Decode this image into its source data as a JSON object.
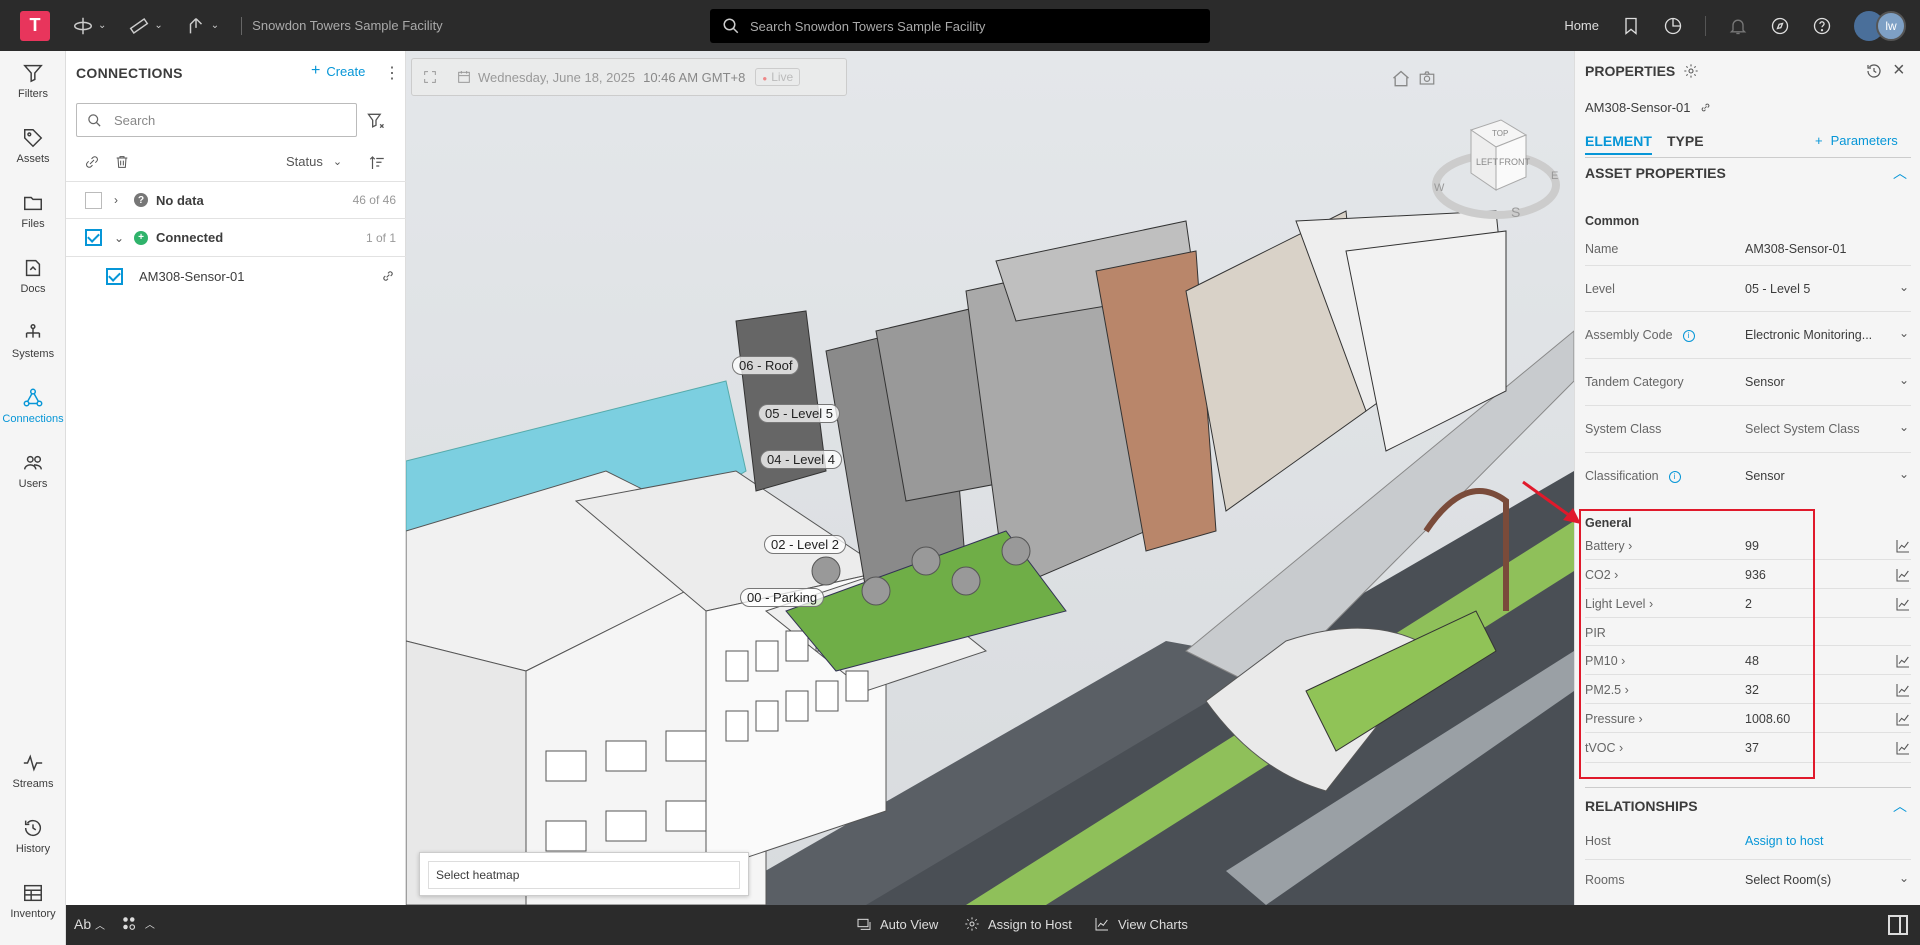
{
  "topbar": {
    "logo_letter": "T",
    "project_name": "Snowdon Towers Sample Facility",
    "search_placeholder": "Search Snowdon Towers Sample Facility",
    "home_label": "Home",
    "avatar_initials": "lw"
  },
  "rail": {
    "items": [
      {
        "label": "Filters",
        "icon": "filter-icon"
      },
      {
        "label": "Assets",
        "icon": "tag-icon"
      },
      {
        "label": "Files",
        "icon": "folder-icon"
      },
      {
        "label": "Docs",
        "icon": "docs-icon"
      },
      {
        "label": "Systems",
        "icon": "hierarchy-icon"
      },
      {
        "label": "Connections",
        "icon": "connections-icon",
        "active": true
      },
      {
        "label": "Users",
        "icon": "users-icon"
      }
    ],
    "bottom_items": [
      {
        "label": "Streams",
        "icon": "pulse-icon"
      },
      {
        "label": "History",
        "icon": "history-icon"
      },
      {
        "label": "Inventory",
        "icon": "table-icon"
      }
    ]
  },
  "connections": {
    "title": "CONNECTIONS",
    "create_label": "Create",
    "search_placeholder": "Search",
    "status_label": "Status",
    "groups": [
      {
        "label": "No data",
        "count": "46 of 46",
        "expanded": false
      },
      {
        "label": "Connected",
        "count": "1 of 1",
        "expanded": true
      }
    ],
    "items": [
      {
        "label": "AM308-Sensor-01"
      }
    ]
  },
  "viewer": {
    "date": "Wednesday, June 18, 2025",
    "time": "10:46 AM GMT+8",
    "live_label": "Live",
    "levels": [
      "06 - Roof",
      "05 - Level 5",
      "04 - Level 4",
      "02 - Level 2",
      "00 - Parking"
    ],
    "heatmap_label": "Select heatmap",
    "cube_labels": {
      "top": "TOP",
      "left": "LEFT",
      "front": "FRONT",
      "south": "S",
      "west": "W",
      "east": "E"
    }
  },
  "properties": {
    "title": "PROPERTIES",
    "asset_name": "AM308-Sensor-01",
    "tabs": [
      "ELEMENT",
      "TYPE"
    ],
    "params_label": "Parameters",
    "asset_section": "ASSET PROPERTIES",
    "common_label": "Common",
    "common": [
      {
        "key": "Name",
        "value": "AM308-Sensor-01"
      },
      {
        "key": "Level",
        "value": "05 - Level 5"
      },
      {
        "key": "Assembly Code",
        "value": "Electronic Monitoring..."
      },
      {
        "key": "Tandem Category",
        "value": "Sensor"
      },
      {
        "key": "System Class",
        "value": "Select System Class"
      },
      {
        "key": "Classification",
        "value": "Sensor"
      }
    ],
    "general_label": "General",
    "general": [
      {
        "key": "Battery",
        "value": "99"
      },
      {
        "key": "CO2",
        "value": "936"
      },
      {
        "key": "Light Level",
        "value": "2"
      },
      {
        "key": "PIR",
        "value": ""
      },
      {
        "key": "PM10",
        "value": "48"
      },
      {
        "key": "PM2.5",
        "value": "32"
      },
      {
        "key": "Pressure",
        "value": "1008.60"
      },
      {
        "key": "tVOC",
        "value": "37"
      }
    ],
    "relationships_section": "RELATIONSHIPS",
    "relationships": [
      {
        "key": "Host",
        "value": "Assign to host"
      },
      {
        "key": "Rooms",
        "value": "Select Room(s)"
      }
    ]
  },
  "bottombar": {
    "text_toggle": "Ab",
    "auto_view": "Auto View",
    "assign_host": "Assign to Host",
    "view_charts": "View Charts"
  },
  "colors": {
    "accent": "#0696d7",
    "brand": "#e8355c",
    "highlight": "#e0192b"
  }
}
